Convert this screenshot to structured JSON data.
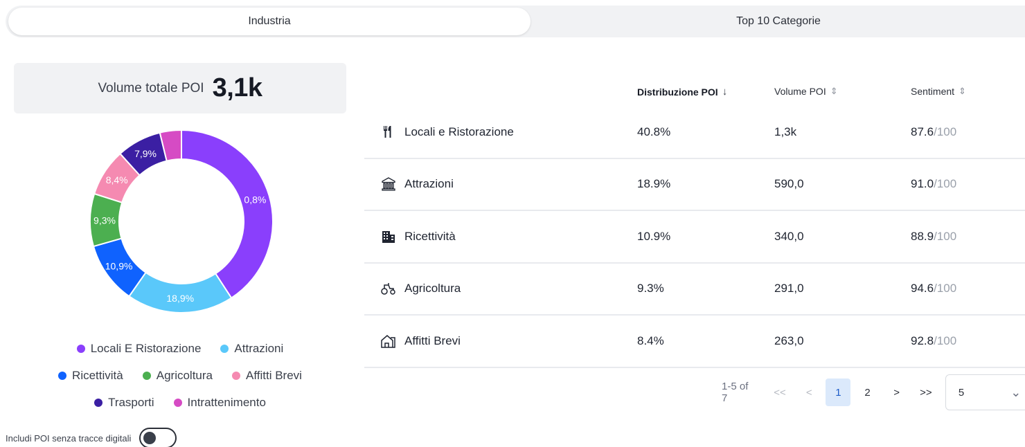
{
  "tabs": [
    {
      "label": "Industria",
      "active": true
    },
    {
      "label": "Top 10 Categorie",
      "active": false
    }
  ],
  "total": {
    "label": "Volume totale POI",
    "value": "3,1k"
  },
  "chart_data": {
    "type": "pie",
    "categories": [
      "Locali E Ristorazione",
      "Attrazioni",
      "Ricettività",
      "Agricoltura",
      "Affitti Brevi",
      "Trasporti",
      "Intrattenimento"
    ],
    "values": [
      40.8,
      18.9,
      10.9,
      9.3,
      8.4,
      7.9,
      3.8
    ],
    "slice_labels": [
      "0,8%",
      "18,9%",
      "10,9%",
      "9,3%",
      "8,4%",
      "7,9%",
      ""
    ],
    "colors": [
      "#8a3ffc",
      "#5ac8fa",
      "#0f62fe",
      "#4caf50",
      "#f58ab1",
      "#3b1fa3",
      "#d64bc4"
    ],
    "legend_rows": [
      [
        "Locali E Ristorazione",
        "Attrazioni"
      ],
      [
        "Ricettività",
        "Agricoltura",
        "Affitti Brevi"
      ],
      [
        "Trasporti",
        "Intrattenimento"
      ]
    ],
    "legend_placement": "bottom"
  },
  "toggle": {
    "label": "Includi POI senza tracce digitali",
    "on": false
  },
  "table": {
    "headers": [
      {
        "label": "Distribuzione POI",
        "sort_icon": "↓"
      },
      {
        "label": "Volume POI",
        "sort_icon": "⇕"
      },
      {
        "label": "Sentiment",
        "sort_icon": "⇕"
      }
    ],
    "rows": [
      {
        "icon": "fork-knife-icon",
        "name": "Locali e Ristorazione",
        "dist": "40.8%",
        "vol": "1,3k",
        "sent": "87.6",
        "sent_max": "/100"
      },
      {
        "icon": "museum-icon",
        "name": "Attrazioni",
        "dist": "18.9%",
        "vol": "590,0",
        "sent": "91.0",
        "sent_max": "/100"
      },
      {
        "icon": "building-icon",
        "name": "Ricettività",
        "dist": "10.9%",
        "vol": "340,0",
        "sent": "88.9",
        "sent_max": "/100"
      },
      {
        "icon": "tractor-icon",
        "name": "Agricoltura",
        "dist": "9.3%",
        "vol": "291,0",
        "sent": "94.6",
        "sent_max": "/100"
      },
      {
        "icon": "home-icon",
        "name": "Affitti Brevi",
        "dist": "8.4%",
        "vol": "263,0",
        "sent": "92.8",
        "sent_max": "/100"
      }
    ]
  },
  "pagination": {
    "range": "1-5 of 7",
    "first": "<<",
    "prev": "<",
    "pages": [
      "1",
      "2"
    ],
    "next": ">",
    "last": ">>",
    "page_size": "5",
    "page_size_caret": "⌄"
  }
}
